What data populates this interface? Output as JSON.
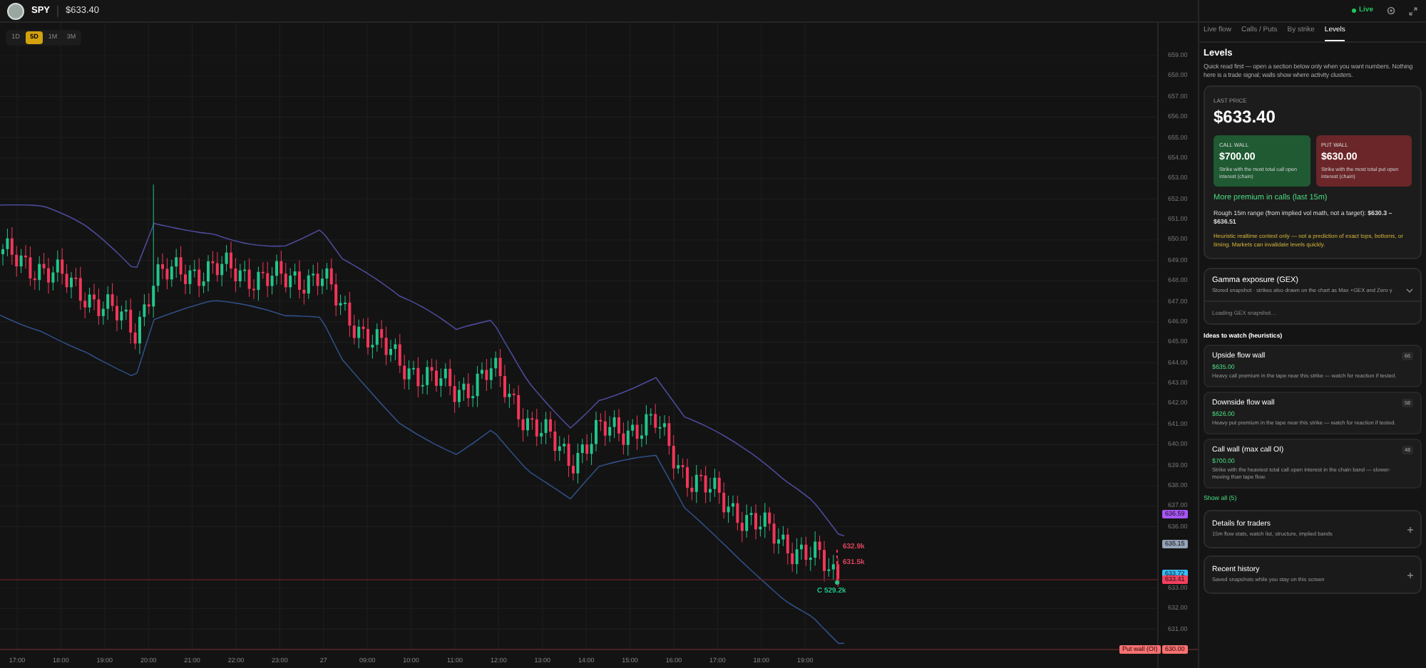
{
  "header": {
    "symbol": "SPY",
    "price": "$633.40"
  },
  "timeframes": [
    {
      "label": "1D",
      "selected": false
    },
    {
      "label": "5D",
      "selected": true
    },
    {
      "label": "1M",
      "selected": false
    },
    {
      "label": "3M",
      "selected": false
    }
  ],
  "status": {
    "label": "Live"
  },
  "chart": {
    "price_axis": [
      "659.00",
      "658.00",
      "657.00",
      "656.00",
      "655.00",
      "654.00",
      "653.00",
      "652.00",
      "651.00",
      "650.00",
      "649.00",
      "648.00",
      "647.00",
      "646.00",
      "645.00",
      "644.00",
      "643.00",
      "642.00",
      "641.00",
      "640.00",
      "639.00",
      "638.00",
      "637.00",
      "636.00",
      "633.00",
      "632.00",
      "631.00"
    ],
    "time_axis": [
      "17:00",
      "18:00",
      "19:00",
      "20:00",
      "21:00",
      "22:00",
      "23:00",
      "27",
      "09:00",
      "10:00",
      "11:00",
      "12:00",
      "13:00",
      "14:00",
      "15:00",
      "16:00",
      "17:00",
      "18:00",
      "19:00"
    ],
    "price_tags": [
      {
        "label": "636.59",
        "color": "#a855f7"
      },
      {
        "label": "635.15",
        "color": "#94a3b8"
      },
      {
        "label": "633.72",
        "color": "#38bdf8"
      },
      {
        "label": "633.41",
        "color": "#f43f5e"
      }
    ],
    "put_wall": {
      "label": "Put wall (OI)",
      "price": "630.00"
    },
    "annotations": [
      {
        "text": "632.9k",
        "color": "#e0455f"
      },
      {
        "text": "631.5k",
        "color": "#e0455f"
      },
      {
        "text": "C 529.2k",
        "color": "#22c58b"
      }
    ]
  },
  "panel": {
    "tabs": [
      {
        "label": "Live flow",
        "selected": false
      },
      {
        "label": "Calls / Puts",
        "selected": false
      },
      {
        "label": "By strike",
        "selected": false
      },
      {
        "label": "Levels",
        "selected": true
      }
    ],
    "title": "Levels",
    "intro": "Quick read first — open a section below only when you want numbers. Nothing here is a trade signal; walls show where activity clusters.",
    "summary": {
      "caption": "LAST PRICE",
      "price": "$633.40",
      "walls": [
        {
          "kind": "call",
          "label": "CALL WALL",
          "value": "$700.00",
          "description": "Strike with the most total call open interest (chain)"
        },
        {
          "kind": "put",
          "label": "PUT WALL",
          "value": "$630.00",
          "description": "Strike with the most total put open interest (chain)"
        }
      ],
      "bias": "More premium in calls (last 15m)",
      "range": "Rough 15m range (from implied vol math, not a target): **$630.3 – $636.51**",
      "caveat": "Heuristic realtime context only — not a prediction of exact tops, bottoms, or timing. Markets can invalidate levels quickly."
    },
    "gex": {
      "title": "Gamma exposure (GEX)",
      "description": "Stored snapshot · strikes also drawn on the chart as Max +GEX and Zero γ",
      "status": "Loading GEX snapshot…"
    },
    "ideas_title": "Ideas to watch (heuristics)",
    "ideas": [
      {
        "title": "Upside flow wall",
        "price": "$635.00",
        "description": "Heavy call premium in the tape near this strike — watch for reaction if tested.",
        "score": "66"
      },
      {
        "title": "Downside flow wall",
        "price": "$626.00",
        "description": "Heavy put premium in the tape near this strike — watch for reaction if tested.",
        "score": "58"
      },
      {
        "title": "Call wall (max call OI)",
        "price": "$700.00",
        "description": "Strike with the heaviest total call open interest in the chain band — slower-moving than tape flow.",
        "score": "48"
      }
    ],
    "show_all": "Show all (5)",
    "sections": [
      {
        "title": "Details for traders",
        "description": "15m flow stats, watch list, structure, implied bands"
      },
      {
        "title": "Recent history",
        "description": "Saved snapshots while you stay on this screen"
      }
    ]
  }
}
